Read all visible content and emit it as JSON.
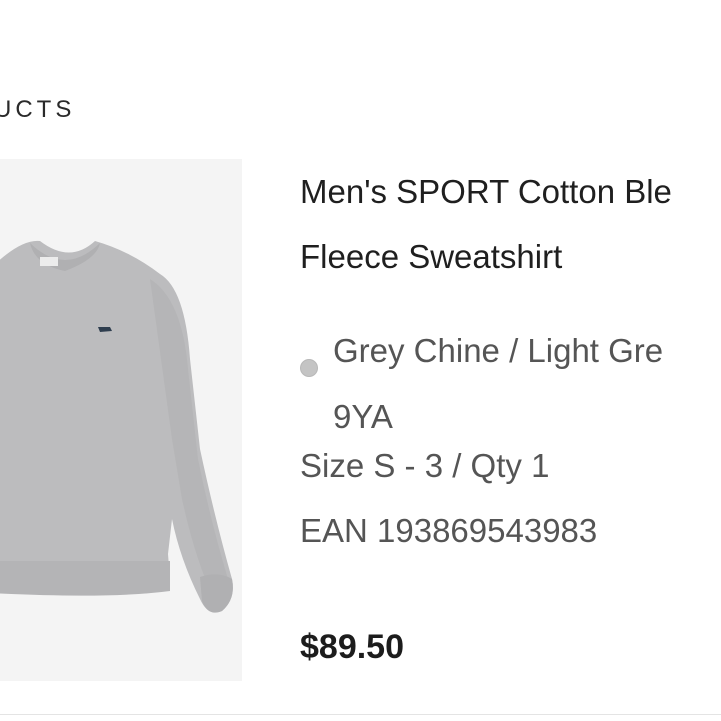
{
  "section": {
    "heading": "UCTS"
  },
  "product": {
    "title_line1": "Men's SPORT Cotton Ble",
    "title_line2": "Fleece Sweatshirt",
    "color_line1": "Grey Chine / Light Gre",
    "color_line2": "9YA",
    "size_qty": "Size S - 3 / Qty 1",
    "ean": "EAN 193869543983",
    "price": "$89.50",
    "image_icon": "sweatshirt-image",
    "swatch_color": "#c4c4c4"
  }
}
